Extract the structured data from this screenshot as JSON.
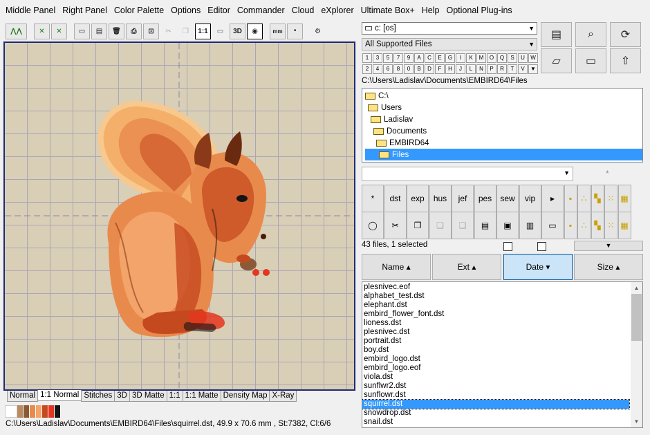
{
  "menu": [
    "Middle Panel",
    "Right Panel",
    "Color Palette",
    "Options",
    "Editor",
    "Commander",
    "Cloud",
    "eXplorer",
    "Ultimate Box+",
    "Help",
    "Optional Plug-ins"
  ],
  "toolbar": {
    "one_to_one": "1:1",
    "three_d": "3D",
    "mm": "mm"
  },
  "view_tabs": [
    "Normal",
    "1:1 Normal",
    "Stitches",
    "3D",
    "3D Matte",
    "1:1",
    "1:1 Matte",
    "Density Map",
    "X-Ray"
  ],
  "palette": [
    "#ffffff",
    "#b98b62",
    "#8a5a37",
    "#e98a4d",
    "#f3a46a",
    "#c5491f",
    "#e4361e",
    "#141414"
  ],
  "status_path": "C:\\Users\\Ladislav\\Documents\\EMBIRD64\\Files\\squirrel.dst, 49.9 x 70.6 mm , St:7382, Cl:6/6",
  "drive": "c: [os]",
  "filter": "All Supported Files",
  "char_row1": [
    "1",
    "3",
    "5",
    "7",
    "9",
    "A",
    "C",
    "E",
    "G",
    "I",
    "K",
    "M",
    "O",
    "Q",
    "S",
    "U",
    "W"
  ],
  "char_row2": [
    "2",
    "4",
    "6",
    "8",
    "0",
    "B",
    "D",
    "F",
    "H",
    "J",
    "L",
    "N",
    "P",
    "R",
    "T",
    "V",
    "▼"
  ],
  "path": "C:\\Users\\Ladislav\\Documents\\EMBIRD64\\Files",
  "tree": [
    "C:\\",
    "Users",
    "Ladislav",
    "Documents",
    "EMBIRD64",
    "Files"
  ],
  "file_types": [
    "*",
    "dst",
    "exp",
    "hus",
    "jef",
    "pes",
    "sew",
    "vip",
    "▸"
  ],
  "file_count": "43 files, 1 selected",
  "sort": {
    "name": "Name ▴",
    "ext": "Ext ▴",
    "date": "Date ▾",
    "size": "Size ▴"
  },
  "files": [
    "plesnivec.eof",
    "alphabet_test.dst",
    "elephant.dst",
    "embird_flower_font.dst",
    "lioness.dst",
    "plesnivec.dst",
    "portrait.dst",
    "boy.dst",
    "embird_logo.dst",
    "embird_logo.eof",
    "viola.dst",
    "sunflwr2.dst",
    "sunflowr.dst",
    "squirrel.dst",
    "snowdrop.dst",
    "snail.dst"
  ],
  "selected_file": "squirrel.dst",
  "asterisk": "*"
}
